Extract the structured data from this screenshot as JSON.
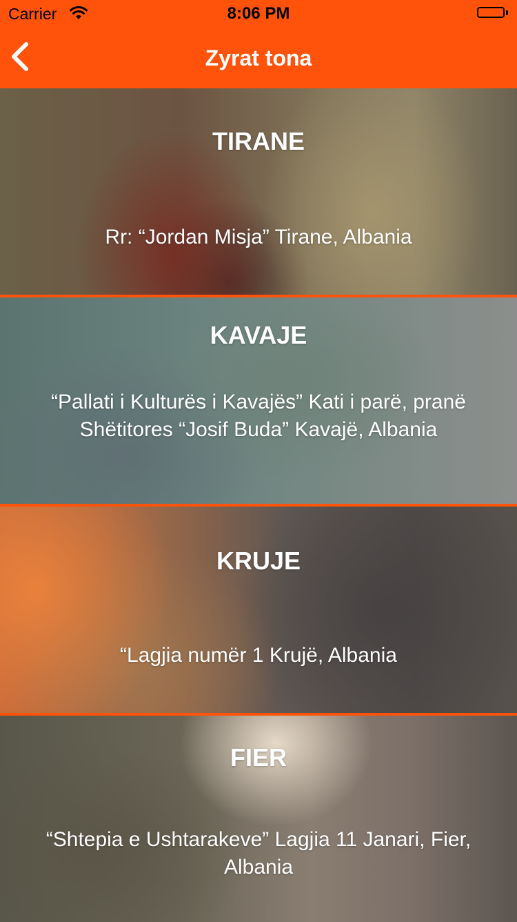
{
  "status_bar": {
    "carrier": "Carrier",
    "time": "8:06 PM"
  },
  "nav": {
    "title": "Zyrat tona",
    "back_icon": "chevron-left-icon"
  },
  "colors": {
    "accent": "#ff520a",
    "text": "#ffffff"
  },
  "offices": [
    {
      "city": "TIRANE",
      "address": "Rr: “Jordan Misja” Tirane, Albania"
    },
    {
      "city": "KAVAJE",
      "address": "“Pallati i Kulturës i Kavajës” Kati i parë, pranë Shëtitores “Josif Buda” Kavajë, Albania"
    },
    {
      "city": "KRUJE",
      "address": "“Lagjia numër 1 Krujë, Albania"
    },
    {
      "city": "FIER",
      "address": "“Shtepia e Ushtarakeve” Lagjia 11 Janari, Fier, Albania"
    }
  ]
}
